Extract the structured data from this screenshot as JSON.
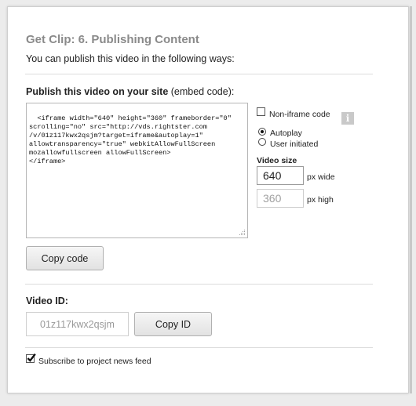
{
  "dialog": {
    "title": "Get Clip: 6. Publishing Content",
    "subtitle": "You can publish this video in the following ways:"
  },
  "embed": {
    "label_bold": "Publish this video on your site",
    "label_rest": " (embed code):",
    "code": "<iframe width=\"640\" height=\"360\" frameborder=\"0\"\nscrolling=\"no\" src=\"http://vds.rightster.com\n/v/01z117kwx2qsjm?target=iframe&autoplay=1\"\nallowtransparency=\"true\" webkitAllowFullScreen\nmozallowfullscreen allowFullScreen>\n</iframe>",
    "copy_button": "Copy code"
  },
  "options": {
    "non_iframe_label": "Non-iframe code",
    "info_icon": "i",
    "autoplay_label": "Autoplay",
    "user_initiated_label": "User initiated",
    "autoplay_selected": true,
    "non_iframe_checked": false
  },
  "video_size": {
    "label": "Video size",
    "width": "640",
    "width_unit": "px wide",
    "height": "360",
    "height_unit": "px high"
  },
  "video_id": {
    "label": "Video ID:",
    "value": "01z117kwx2qsjm",
    "copy_button": "Copy ID"
  },
  "footer": {
    "subscribe_label": "Subscribe to project news feed",
    "subscribe_checked": true
  }
}
